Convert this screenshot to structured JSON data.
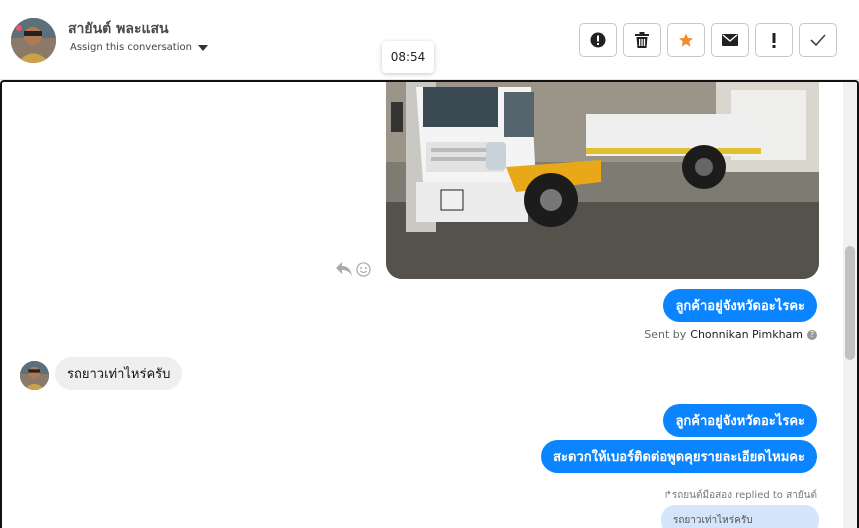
{
  "header": {
    "contact_name": "สายันต์ พละแสน",
    "assign_label": "Assign this conversation",
    "actions": [
      {
        "icon": "alert-circle-icon",
        "label": "spam"
      },
      {
        "icon": "trash-icon",
        "label": "delete"
      },
      {
        "icon": "star-icon",
        "label": "star"
      },
      {
        "icon": "envelope-icon",
        "label": "unread"
      },
      {
        "icon": "exclamation-icon",
        "label": "follow-up"
      },
      {
        "icon": "checkmark-icon",
        "label": "done"
      }
    ]
  },
  "tooltip": {
    "time": "08:54"
  },
  "thread": {
    "outgoing_1": "ลูกค้าอยู่จังหวัดอะไรคะ",
    "sent_by_prefix": "Sent by",
    "sent_by_name": "Chonnikan Pimkham",
    "incoming_1": "รถยาวเท่าไหร่ครับ",
    "outgoing_2": "ลูกค้าอยู่จังหวัดอะไรคะ",
    "outgoing_3": "สะดวกให้เบอร์ติดต่อพูดคุยรายละเอียดไหมคะ",
    "replied_note": "↱รถยนต์มือสอง replied to สายันต์",
    "quoted_text": "รถยาวเท่าไหร่ครับ"
  },
  "colors": {
    "accent": "#0a84ff",
    "star": "#f08c2a",
    "incoming_bubble": "#efefef"
  }
}
